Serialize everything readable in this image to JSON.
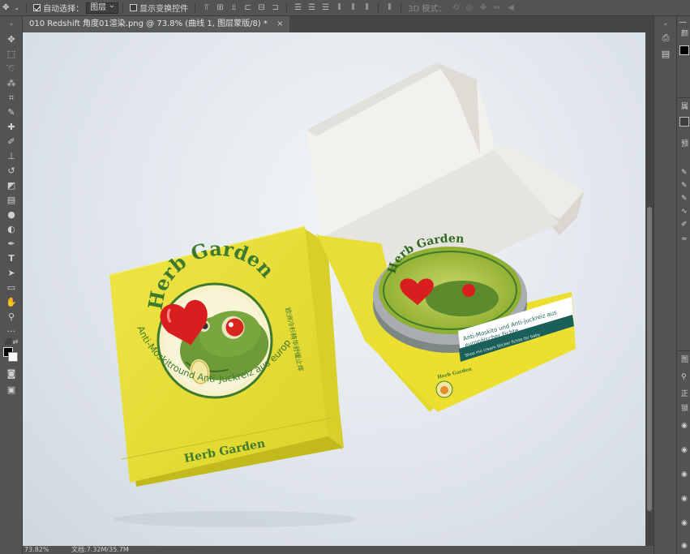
{
  "options_bar": {
    "auto_select_label": "自动选择：",
    "auto_select_checked": true,
    "layer_select": "图层",
    "show_transform_label": "显示变换控件",
    "mode_3d_label": "3D 模式："
  },
  "document": {
    "tab_title": "010 Redshift 角度01渲染.png @ 73.8% (曲线 1, 图层蒙版/8) *",
    "close_glyph": "×"
  },
  "status_bar": {
    "zoom": "73.82%",
    "doc_size": "文档:7.32M/35.7M",
    "arrow": "›"
  },
  "window_controls": {
    "minimize": "—",
    "restore": "❐"
  },
  "right_panel": {
    "color_label": "颜",
    "properties_label": "属",
    "presets_label": "预",
    "layers_label": "图",
    "normal_label": "正",
    "lock_label": "锁"
  },
  "artwork": {
    "brand": "Herb Garden",
    "ring_text": "Anti-Moskitround Anti-Juckreiz aus europäischer Fichte",
    "side_text_cn": "欧洲冷杉精华舒缓止痒",
    "sleeve_line1": "Anti-Moskito und Anti-Juckreiz aus",
    "sleeve_line2": "europäischer Fichte",
    "sleeve_sub": "Shoo mo cream Sticker fichte for baby"
  },
  "colors": {
    "box_yellow": "#e9e03a",
    "box_shadow": "#c9c21c",
    "brand_green": "#3e7a2e",
    "heart_red": "#d81e1e",
    "sleeve_teal": "#1b5f5a"
  }
}
